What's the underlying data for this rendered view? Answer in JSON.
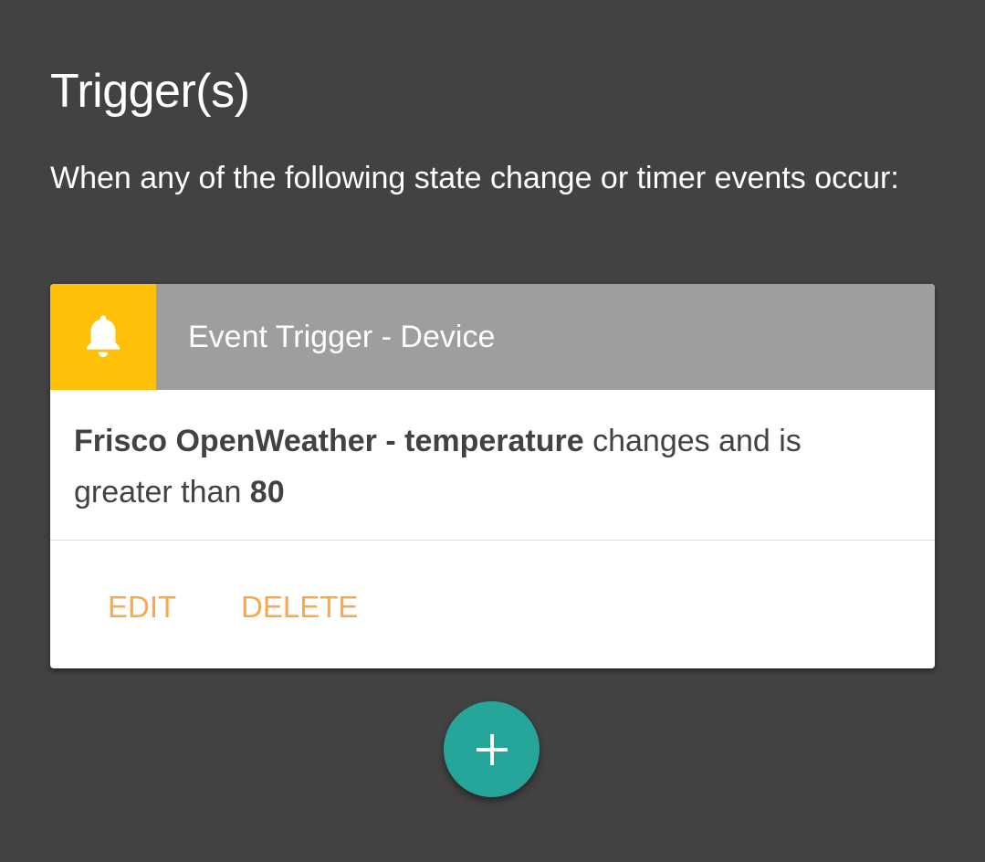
{
  "section": {
    "title": "Trigger(s)",
    "description": "When any of the following state change or timer events occur:"
  },
  "trigger_card": {
    "icon": "bell-icon",
    "header_title": "Event Trigger - Device",
    "body": {
      "device": "Frisco OpenWeather",
      "separator": " - ",
      "attribute": "temperature",
      "condition_text": " changes and is greater than ",
      "value": "80"
    },
    "actions": {
      "edit_label": "EDIT",
      "delete_label": "DELETE"
    }
  },
  "add_button": {
    "icon": "plus-icon"
  },
  "colors": {
    "background": "#424242",
    "header_bg": "#9e9e9e",
    "icon_bg": "#ffc107",
    "action_text": "#f9a947",
    "fab_bg": "#26a69a"
  }
}
